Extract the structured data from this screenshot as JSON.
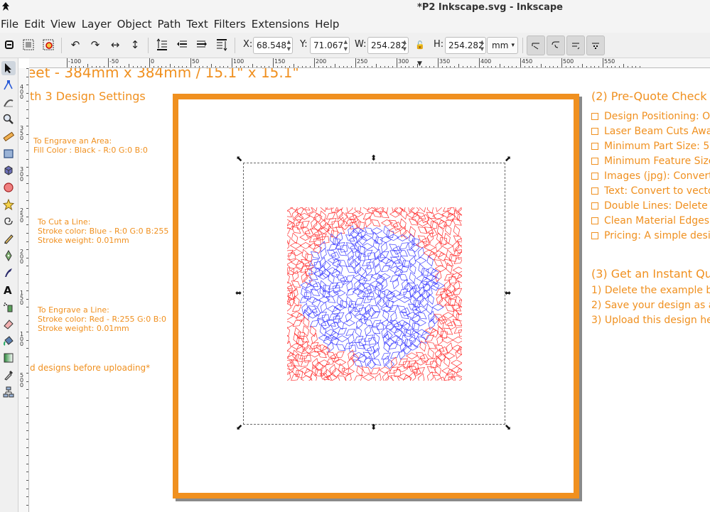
{
  "window": {
    "title": "*P2 Inkscape.svg - Inkscape"
  },
  "menu": [
    "File",
    "Edit",
    "View",
    "Layer",
    "Object",
    "Path",
    "Text",
    "Filters",
    "Extensions",
    "Help"
  ],
  "toolbar": {
    "x_label": "X:",
    "x_value": "68.548",
    "y_label": "Y:",
    "y_value": "71.067",
    "w_label": "W:",
    "w_value": "254.282",
    "h_label": "H:",
    "h_value": "254.282",
    "unit": "mm"
  },
  "ruler": {
    "h_labels": [
      "-100",
      "-50",
      "0",
      "50",
      "100",
      "150",
      "200",
      "250",
      "300",
      "350",
      "400",
      "450",
      "500",
      "550"
    ],
    "v_labels": [
      "4",
      "0",
      "0",
      "3",
      "5",
      "0",
      "3",
      "0",
      "0",
      "2",
      "5",
      "0",
      "2",
      "0",
      "0",
      "1",
      "5",
      "0",
      "1",
      "0",
      "0",
      "5",
      "0",
      "0"
    ]
  },
  "canvas": {
    "heading": "eet - 384mm x 384mm / 15.1\" x 15.1\"",
    "subheading": "th 3 Design Settings",
    "engrave_area": "To Engrave an Area:\nFill Color : Black - R:0 G:0 B:0",
    "cut_line": "To Cut a Line:\nStroke color: Blue - R:0 G:0 B:255\nStroke weight: 0.01mm",
    "engrave_line": "To Engrave a Line:\nStroke color: Red - R:255 G:0 B:0\nStroke weight: 0.01mm",
    "footer_note": "d designs before uploading*",
    "prequote_title": "(2) Pre-Quote Check",
    "checklist": [
      "Design Positioning: O",
      "Laser Beam Cuts Awa",
      "Minimum Part Size: 5",
      "Minimum Feature Size",
      "Images (jpg): Convert",
      "Text: Convert to vecto",
      "Double Lines: Delete",
      "Clean Material Edges",
      "Pricing: A simple desi"
    ],
    "quote_title": "(3) Get an Instant Qu",
    "steps": [
      "1) Delete the example b",
      "2) Save your design as a",
      "3) Upload this design he"
    ]
  },
  "colors": {
    "accent": "#f0901f",
    "cut_blue": "#4040ff",
    "engrave_red": "#ff3030"
  },
  "icons": {
    "tools": [
      "selector-icon",
      "node-icon",
      "tweak-icon",
      "zoom-icon",
      "measure-icon",
      "rectangle-icon",
      "3dbox-icon",
      "ellipse-icon",
      "star-icon",
      "spiral-icon",
      "pencil-icon",
      "pen-icon",
      "calligraphy-icon",
      "text-icon",
      "spray-icon",
      "eraser-icon",
      "bucket-icon",
      "gradient-icon",
      "dropper-icon",
      "connector-icon"
    ]
  }
}
